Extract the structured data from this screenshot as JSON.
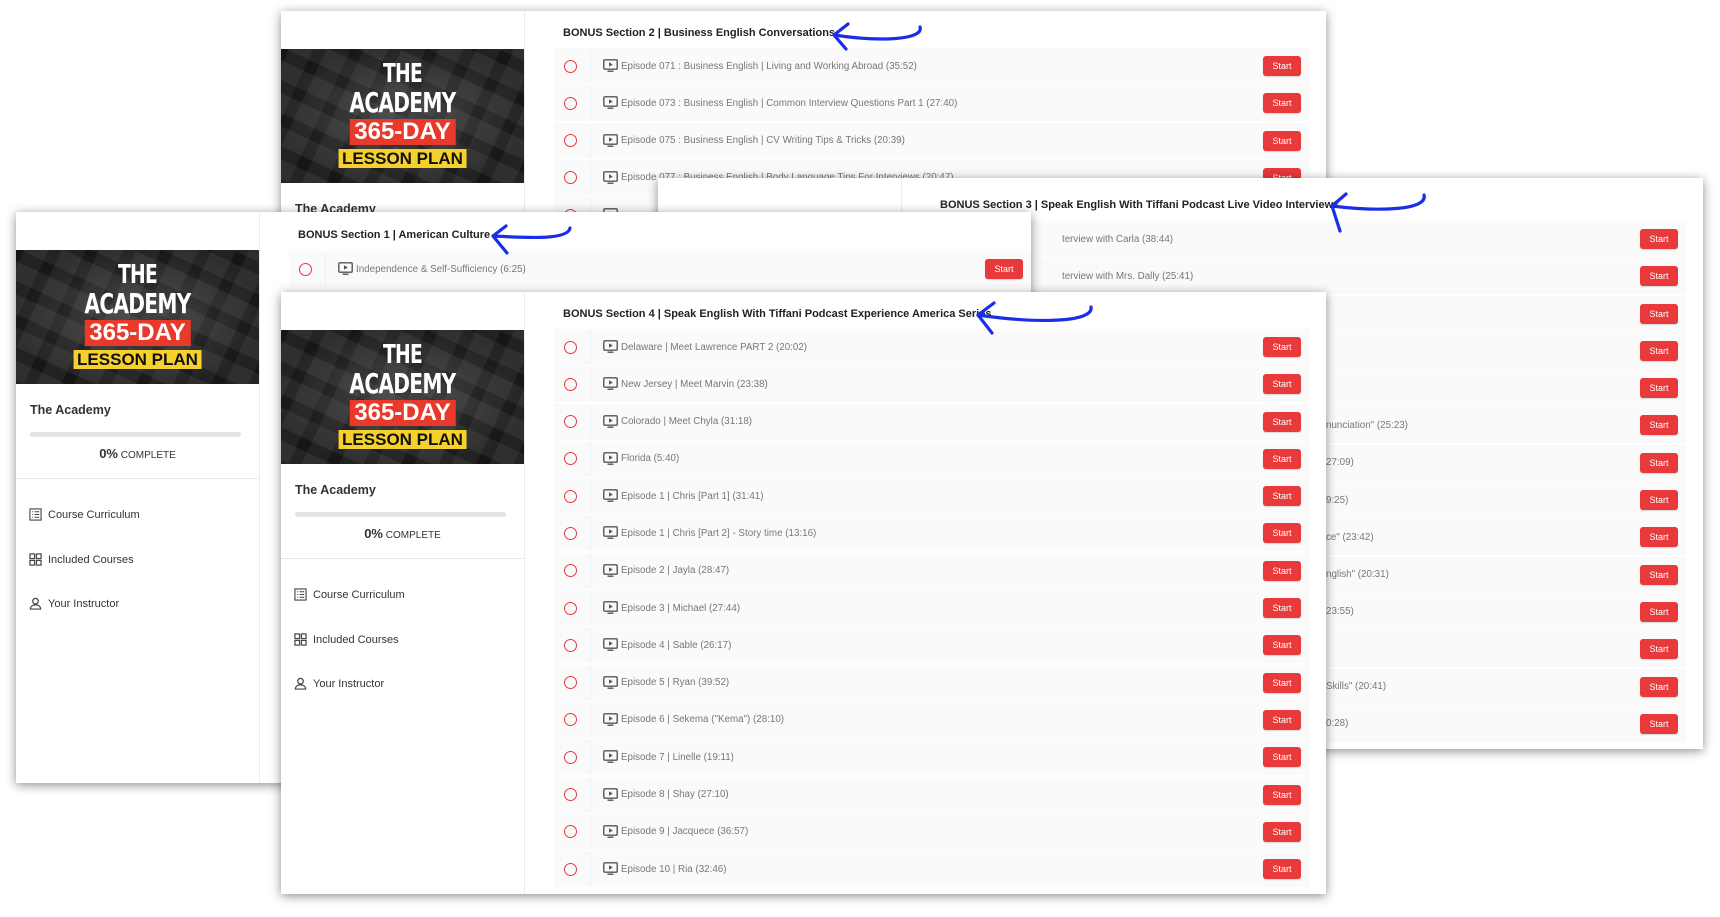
{
  "accent_color": "#e8393b",
  "annotation_color": "#1a2ee6",
  "course": {
    "thumb_line1": "THE",
    "thumb_line2": "ACADEMY",
    "thumb_line3": "365-DAY",
    "thumb_line4": "LESSON PLAN",
    "title": "The Academy",
    "progress_percent": "0%",
    "progress_value": 0,
    "complete_label": "COMPLETE"
  },
  "menu": [
    {
      "label": "Course Curriculum",
      "icon": "list-icon"
    },
    {
      "label": "Included Courses",
      "icon": "grid-icon"
    },
    {
      "label": "Your Instructor",
      "icon": "user-icon"
    }
  ],
  "start_label": "Start",
  "windows": {
    "section2": {
      "title": "BONUS Section 2 | Business English Conversations",
      "lectures": [
        "Episode 071 : Business English | Living and Working Abroad (35:52)",
        "Episode 073 : Business English | Common Interview Questions Part 1 (27:40)",
        "Episode 075 : Business English | CV Writing Tips & Tricks (20:39)",
        "Episode 077 : Business English | Body Language Tips For Interviews (20:47)",
        ""
      ]
    },
    "section3": {
      "title": "BONUS Section 3 | Speak English With Tiffani Podcast Live Video Interviews",
      "lectures_visible_fragments": [
        "terview with Carla (38:44)",
        "terview with Mrs. Dally (25:41)",
        "",
        "",
        "",
        "nunciation\" (25:23)",
        "27:09)",
        "9:25)",
        "ce\" (23:42)",
        "nglish\" (20:31)",
        "23:55)",
        "",
        "Skills\" (20:41)",
        "0:28)"
      ]
    },
    "section1": {
      "title": "BONUS Section 1 | American Culture",
      "lectures": [
        "Independence & Self-Sufficiency (6:25)"
      ]
    },
    "section4": {
      "title": "BONUS Section 4 | Speak English With Tiffani Podcast Experience America Series",
      "lectures": [
        "Delaware | Meet Lawrence PART 2 (20:02)",
        "New Jersey | Meet Marvin (23:38)",
        "Colorado | Meet Chyla (31:18)",
        "Florida (5:40)",
        "Episode 1 | Chris [Part 1] (31:41)",
        "Episode 1 | Chris [Part 2] - Story time (13:16)",
        "Episode 2 | Jayla (28:47)",
        "Episode 3 | Michael (27:44)",
        "Episode 4 | Sable (26:17)",
        "Episode 5 | Ryan (39:52)",
        "Episode 6 | Sekema (\"Kema\") (28:10)",
        "Episode 7 | Linelle (19:11)",
        "Episode 8 | Shay (27:10)",
        "Episode 9 | Jacquece (36:57)",
        "Episode 10 | Ria (32:46)"
      ]
    }
  }
}
